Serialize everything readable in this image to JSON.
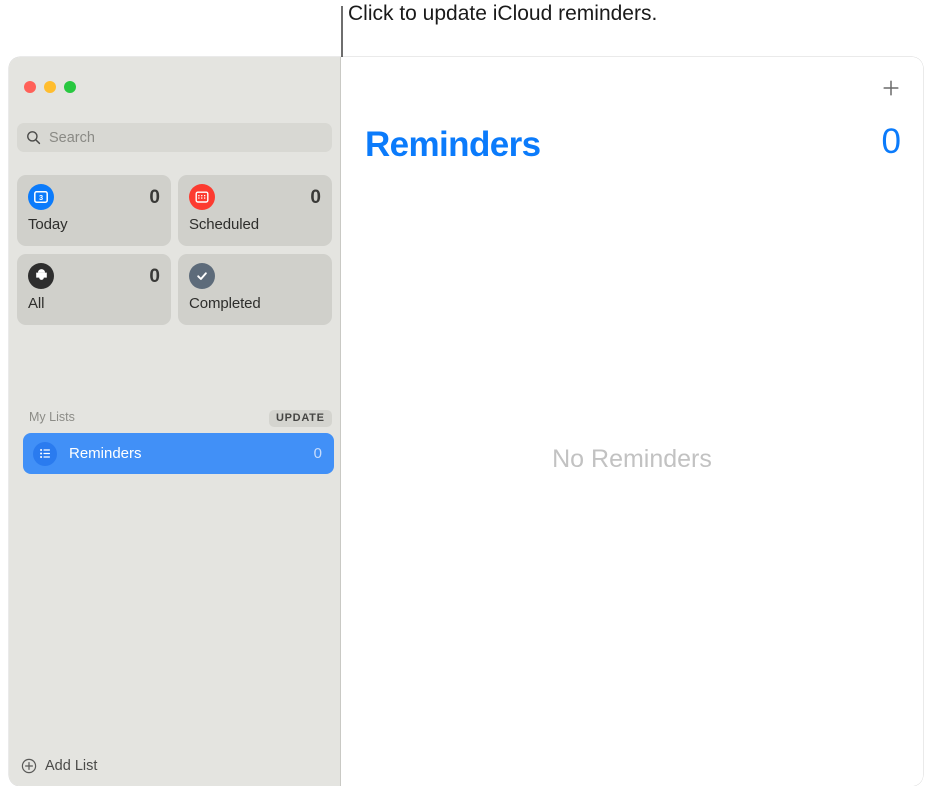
{
  "callout": {
    "text": "Click to update iCloud reminders."
  },
  "window": {
    "traffic_lights": {
      "close_label": "close",
      "minimize_label": "minimize",
      "zoom_label": "zoom",
      "close_color": "#ff6159",
      "minimize_color": "#ffbd2e",
      "zoom_color": "#28c840"
    }
  },
  "sidebar": {
    "search": {
      "placeholder": "Search",
      "value": "",
      "icon": "search-icon"
    },
    "smart_lists": [
      {
        "label": "Today",
        "count": "0",
        "icon": "calendar-day-icon",
        "icon_color": "#0b7bfb",
        "badge": "3"
      },
      {
        "label": "Scheduled",
        "count": "0",
        "icon": "calendar-icon",
        "icon_color": "#fc3b30"
      },
      {
        "label": "All",
        "count": "0",
        "icon": "inbox-tray-icon",
        "icon_color": "#2e2e2e"
      },
      {
        "label": "Completed",
        "count": "",
        "icon": "checkmark-icon",
        "icon_color": "#5d6b7a"
      }
    ],
    "my_lists": {
      "header": "My Lists",
      "update_button": "UPDATE",
      "items": [
        {
          "label": "Reminders",
          "count": "0",
          "icon": "bulleted-list-icon",
          "selected": true
        }
      ]
    },
    "add_list": {
      "label": "Add List",
      "icon": "plus-circle-icon"
    }
  },
  "detail": {
    "add_button_icon": "plus-icon",
    "title": "Reminders",
    "count": "0",
    "empty_state": "No Reminders",
    "accent_color": "#0b7bfb"
  }
}
